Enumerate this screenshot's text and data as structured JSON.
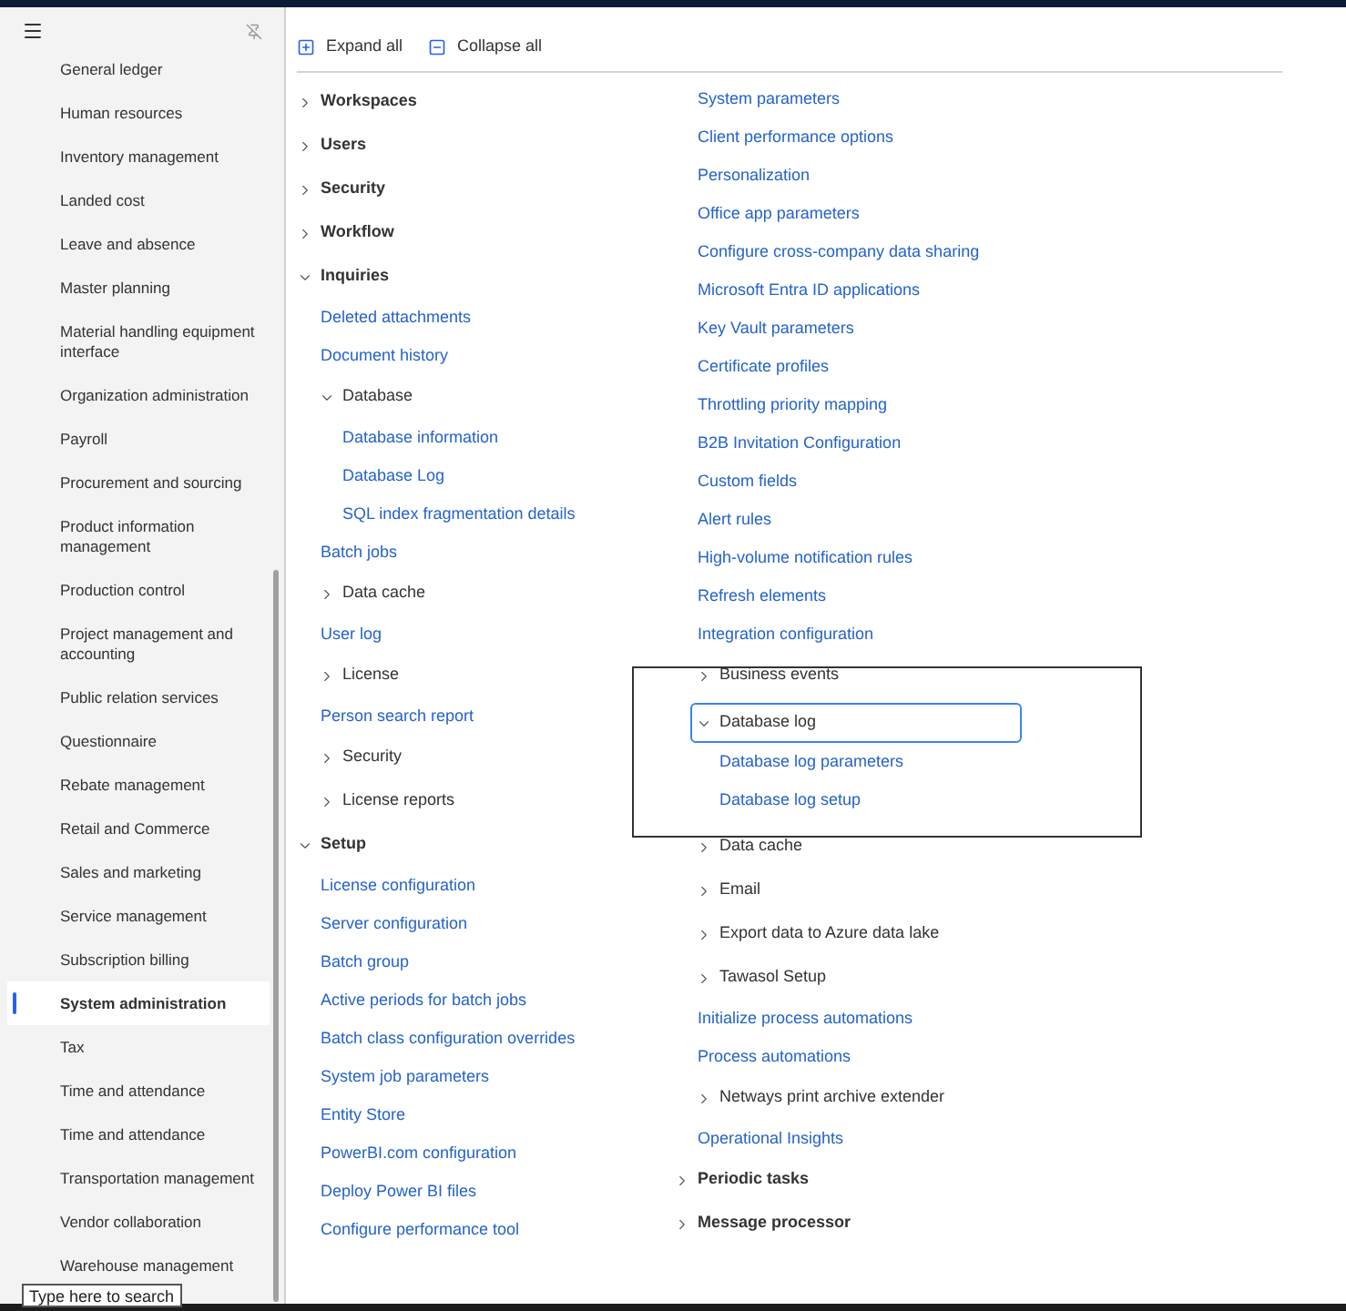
{
  "sidebar": {
    "items": [
      {
        "label": "General ledger",
        "selected": false
      },
      {
        "label": "Human resources",
        "selected": false
      },
      {
        "label": "Inventory management",
        "selected": false
      },
      {
        "label": "Landed cost",
        "selected": false
      },
      {
        "label": "Leave and absence",
        "selected": false
      },
      {
        "label": "Master planning",
        "selected": false
      },
      {
        "label": "Material handling equipment interface",
        "selected": false
      },
      {
        "label": "Organization administration",
        "selected": false
      },
      {
        "label": "Payroll",
        "selected": false
      },
      {
        "label": "Procurement and sourcing",
        "selected": false
      },
      {
        "label": "Product information management",
        "selected": false
      },
      {
        "label": "Production control",
        "selected": false
      },
      {
        "label": "Project management and accounting",
        "selected": false
      },
      {
        "label": "Public relation services",
        "selected": false
      },
      {
        "label": "Questionnaire",
        "selected": false
      },
      {
        "label": "Rebate management",
        "selected": false
      },
      {
        "label": "Retail and Commerce",
        "selected": false
      },
      {
        "label": "Sales and marketing",
        "selected": false
      },
      {
        "label": "Service management",
        "selected": false
      },
      {
        "label": "Subscription billing",
        "selected": false
      },
      {
        "label": "System administration",
        "selected": true
      },
      {
        "label": "Tax",
        "selected": false
      },
      {
        "label": "Time and attendance",
        "selected": false
      },
      {
        "label": "Time and attendance",
        "selected": false
      },
      {
        "label": "Transportation management",
        "selected": false
      },
      {
        "label": "Vendor collaboration",
        "selected": false
      },
      {
        "label": "Warehouse management",
        "selected": false
      }
    ]
  },
  "toolbar": [
    {
      "label": "Expand all",
      "kind": "expand"
    },
    {
      "label": "Collapse all",
      "kind": "collapse"
    }
  ],
  "columns": [
    {
      "items": [
        {
          "kind": "group",
          "label": "Workspaces",
          "expanded": false
        },
        {
          "kind": "group",
          "label": "Users",
          "expanded": false
        },
        {
          "kind": "group",
          "label": "Security",
          "expanded": false
        },
        {
          "kind": "group",
          "label": "Workflow",
          "expanded": false
        },
        {
          "kind": "group",
          "label": "Inquiries",
          "expanded": true,
          "children": [
            {
              "kind": "link",
              "label": "Deleted attachments"
            },
            {
              "kind": "link",
              "label": "Document history"
            },
            {
              "kind": "group",
              "label": "Database",
              "expanded": true,
              "children": [
                {
                  "kind": "link",
                  "label": "Database information"
                },
                {
                  "kind": "link",
                  "label": "Database Log"
                },
                {
                  "kind": "link",
                  "label": "SQL index fragmentation details"
                }
              ]
            },
            {
              "kind": "link",
              "label": "Batch jobs"
            },
            {
              "kind": "group",
              "label": "Data cache",
              "expanded": false
            },
            {
              "kind": "link",
              "label": "User log"
            },
            {
              "kind": "group",
              "label": "License",
              "expanded": false
            },
            {
              "kind": "link",
              "label": "Person search report"
            },
            {
              "kind": "group",
              "label": "Security",
              "expanded": false
            },
            {
              "kind": "group",
              "label": "License reports",
              "expanded": false
            }
          ]
        },
        {
          "kind": "group",
          "label": "Setup",
          "expanded": true,
          "children": [
            {
              "kind": "link",
              "label": "License configuration"
            },
            {
              "kind": "link",
              "label": "Server configuration"
            },
            {
              "kind": "link",
              "label": "Batch group"
            },
            {
              "kind": "link",
              "label": "Active periods for batch jobs"
            },
            {
              "kind": "link",
              "label": "Batch class configuration overrides"
            },
            {
              "kind": "link",
              "label": "System job parameters"
            },
            {
              "kind": "link",
              "label": "Entity Store"
            },
            {
              "kind": "link",
              "label": "PowerBI.com configuration"
            },
            {
              "kind": "link",
              "label": "Deploy Power BI files"
            },
            {
              "kind": "link",
              "label": "Configure performance tool"
            }
          ]
        }
      ]
    },
    {
      "continuation": [
        {
          "kind": "link",
          "label": "System parameters"
        },
        {
          "kind": "link",
          "label": "Client performance options"
        },
        {
          "kind": "link",
          "label": "Personalization"
        },
        {
          "kind": "link",
          "label": "Office app parameters"
        },
        {
          "kind": "link",
          "label": "Configure cross-company data sharing"
        },
        {
          "kind": "link",
          "label": "Microsoft Entra ID applications"
        },
        {
          "kind": "link",
          "label": "Key Vault parameters"
        },
        {
          "kind": "link",
          "label": "Certificate profiles"
        },
        {
          "kind": "link",
          "label": "Throttling priority mapping"
        },
        {
          "kind": "link",
          "label": "B2B Invitation Configuration"
        },
        {
          "kind": "link",
          "label": "Custom fields"
        },
        {
          "kind": "link",
          "label": "Alert rules"
        },
        {
          "kind": "link",
          "label": "High-volume notification rules"
        },
        {
          "kind": "link",
          "label": "Refresh elements"
        },
        {
          "kind": "link",
          "label": "Integration configuration"
        },
        {
          "kind": "group",
          "label": "Business events",
          "expanded": false
        },
        {
          "kind": "group",
          "label": "Database log",
          "expanded": true,
          "focused": true,
          "children": [
            {
              "kind": "link",
              "label": "Database log parameters"
            },
            {
              "kind": "link",
              "label": "Database log setup"
            }
          ]
        },
        {
          "kind": "group",
          "label": "Data cache",
          "expanded": false
        },
        {
          "kind": "group",
          "label": "Email",
          "expanded": false
        },
        {
          "kind": "group",
          "label": "Export data to Azure data lake",
          "expanded": false
        },
        {
          "kind": "group",
          "label": "Tawasol Setup",
          "expanded": false
        },
        {
          "kind": "link",
          "label": "Initialize process automations"
        },
        {
          "kind": "link",
          "label": "Process automations"
        },
        {
          "kind": "group",
          "label": "Netways print archive extender",
          "expanded": false
        },
        {
          "kind": "link",
          "label": "Operational Insights"
        }
      ],
      "items": [
        {
          "kind": "group",
          "label": "Periodic tasks",
          "expanded": false
        },
        {
          "kind": "group",
          "label": "Message processor",
          "expanded": false
        }
      ]
    }
  ],
  "tooltip": {
    "text": "Type here to search"
  }
}
